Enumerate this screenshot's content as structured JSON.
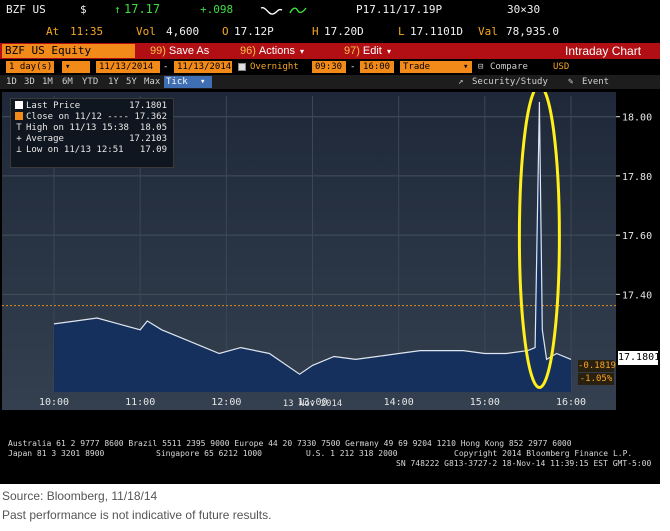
{
  "header": {
    "ticker": "BZF US",
    "currency_symbol": "$",
    "arrow": "↑",
    "last": "17.17",
    "change": "+.098",
    "bid_ask": "P17.11/17.19P",
    "size": "30×30",
    "at_label": "At",
    "time": "11:35",
    "vol_label": "Vol",
    "volume": "4,600",
    "open_label": "O",
    "open": "17.12P",
    "high_label": "H",
    "high": "17.20D",
    "low_label": "L",
    "low": "17.1101D",
    "val_label": "Val",
    "value": "78,935.0"
  },
  "menu": {
    "security": "BZF US Equity",
    "save_num": "99)",
    "save": "Save As",
    "actions_num": "96)",
    "actions": "Actions",
    "edit_num": "97)",
    "edit": "Edit",
    "title": "Intraday Chart"
  },
  "params": {
    "period_value": "1",
    "period_unit": "day(s)",
    "start_date": "11/13/2014",
    "end_date": "11/13/2014",
    "overnight": "Overnight",
    "start_time": "09:30",
    "dash": "-",
    "end_time": "16:00",
    "trade": "Trade",
    "compare": "Compare",
    "currency": "USD"
  },
  "periods": {
    "buttons": [
      "1D",
      "3D",
      "1M",
      "6M",
      "YTD",
      "1Y",
      "5Y",
      "Max",
      "Tick"
    ],
    "selected": "Tick",
    "security_study": "Security/Study",
    "event": "Event"
  },
  "legend": {
    "last_label": "Last Price",
    "last_value": "17.1801",
    "close_label": "Close on 11/12 ----",
    "close_value": "17.362",
    "high_label": "High on 11/13 15:38",
    "high_value": "18.05",
    "avg_label": "Average",
    "avg_value": "17.2103",
    "low_label": "Low on 11/13 12:51",
    "low_value": "17.09"
  },
  "colors": {
    "amber": "#f6a623",
    "price_line": "#dfe6f0",
    "fill": "#15305c",
    "highlight": "#ffef1a",
    "close_line": "#e8891f"
  },
  "chart_data": {
    "type": "area",
    "x": [
      "10:00",
      "10:15",
      "10:30",
      "10:45",
      "11:00",
      "11:05",
      "11:15",
      "11:30",
      "11:45",
      "11:55",
      "12:10",
      "12:30",
      "12:51",
      "13:00",
      "13:15",
      "13:30",
      "13:45",
      "14:00",
      "14:15",
      "14:30",
      "14:45",
      "15:00",
      "15:15",
      "15:30",
      "15:35",
      "15:38",
      "15:40",
      "15:43",
      "15:50",
      "16:00"
    ],
    "values": [
      17.3,
      17.31,
      17.32,
      17.3,
      17.28,
      17.31,
      17.28,
      17.25,
      17.22,
      17.2,
      17.22,
      17.2,
      17.13,
      17.16,
      17.19,
      17.18,
      17.19,
      17.2,
      17.21,
      17.21,
      17.21,
      17.2,
      17.2,
      17.21,
      17.22,
      18.05,
      17.28,
      17.18,
      17.2,
      17.18
    ],
    "ylim": [
      17.07,
      18.07
    ],
    "y_ticks": [
      "18.00",
      "17.80",
      "17.60",
      "17.40"
    ],
    "x_ticks": [
      "10:00",
      "11:00",
      "12:00",
      "13:00",
      "14:00",
      "15:00",
      "16:00"
    ],
    "xlabel": "13 Nov 2014",
    "close_level": 17.362,
    "last_tag": "17.1801",
    "change_tag": "-0.1819",
    "pct_tag": "-1.05%"
  },
  "footer": {
    "line1": "Australia 61 2 9777 8600 Brazil 5511 2395 9000 Europe 44 20 7330 7500 Germany 49 69 9204 1210 Hong Kong 852 2977 6000",
    "line2a": "Japan 81 3 3201 8900",
    "line2b": "Singapore 65 6212 1000",
    "line2c": "U.S. 1 212 318 2000",
    "line2d": "Copyright 2014 Bloomberg Finance L.P.",
    "line3": "SN 748222 G813-3727-2 18-Nov-14 11:39:15 EST  GMT-5:00"
  },
  "captions": {
    "source": "Source: Bloomberg, 11/18/14",
    "disclaimer": "Past performance is not indicative of future results."
  }
}
